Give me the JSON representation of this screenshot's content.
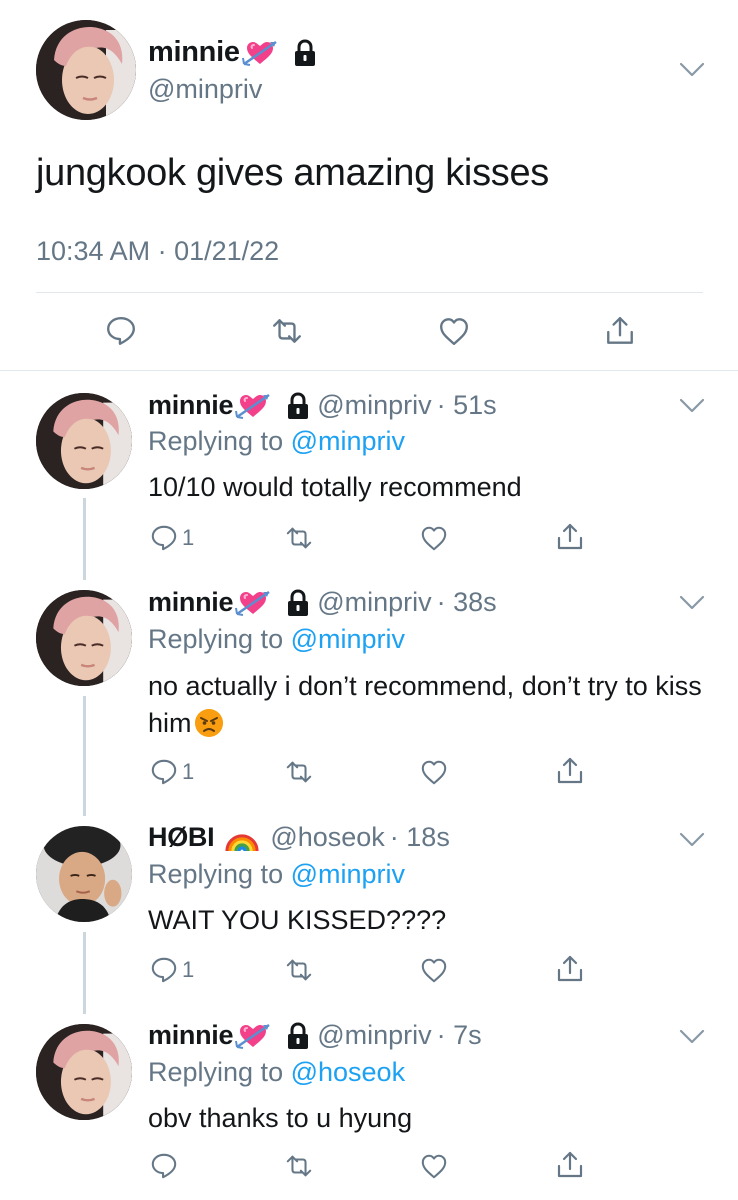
{
  "main_tweet": {
    "name": "minnie",
    "handle": "@minpriv",
    "text": "jungkook gives amazing kisses",
    "timestamp": "10:34 AM · 01/21/22",
    "icons": [
      "sparkling-heart-arrow-emoji",
      "lock-icon",
      "chevron-down-icon",
      "reply-icon",
      "retweet-icon",
      "like-icon",
      "share-icon"
    ]
  },
  "replies": [
    {
      "name": "minnie",
      "handle": "@minpriv",
      "age": "· 51s",
      "replying_prefix": "Replying to ",
      "replying_to": "@minpriv",
      "text": "10/10 would totally recommend",
      "reply_count": "1"
    },
    {
      "name": "minnie",
      "handle": "@minpriv",
      "age": "· 38s",
      "replying_prefix": "Replying to ",
      "replying_to": "@minpriv",
      "text": "no actually i don’t recommend, don’t try to kiss him",
      "reply_count": "1"
    },
    {
      "name": "HØBI",
      "handle": "@hoseok",
      "age": "· 18s",
      "replying_prefix": "Replying to ",
      "replying_to": "@minpriv",
      "text": "WAIT YOU KISSED????",
      "reply_count": "1"
    },
    {
      "name": "minnie",
      "handle": "@minpriv",
      "age": "· 7s",
      "replying_prefix": "Replying to ",
      "replying_to": "@hoseok",
      "text": "obv thanks to u hyung",
      "reply_count": ""
    }
  ],
  "colors": {
    "text": "#14171a",
    "secondary": "#657786",
    "link": "#1da1f2",
    "divider": "#e1e8ed"
  }
}
